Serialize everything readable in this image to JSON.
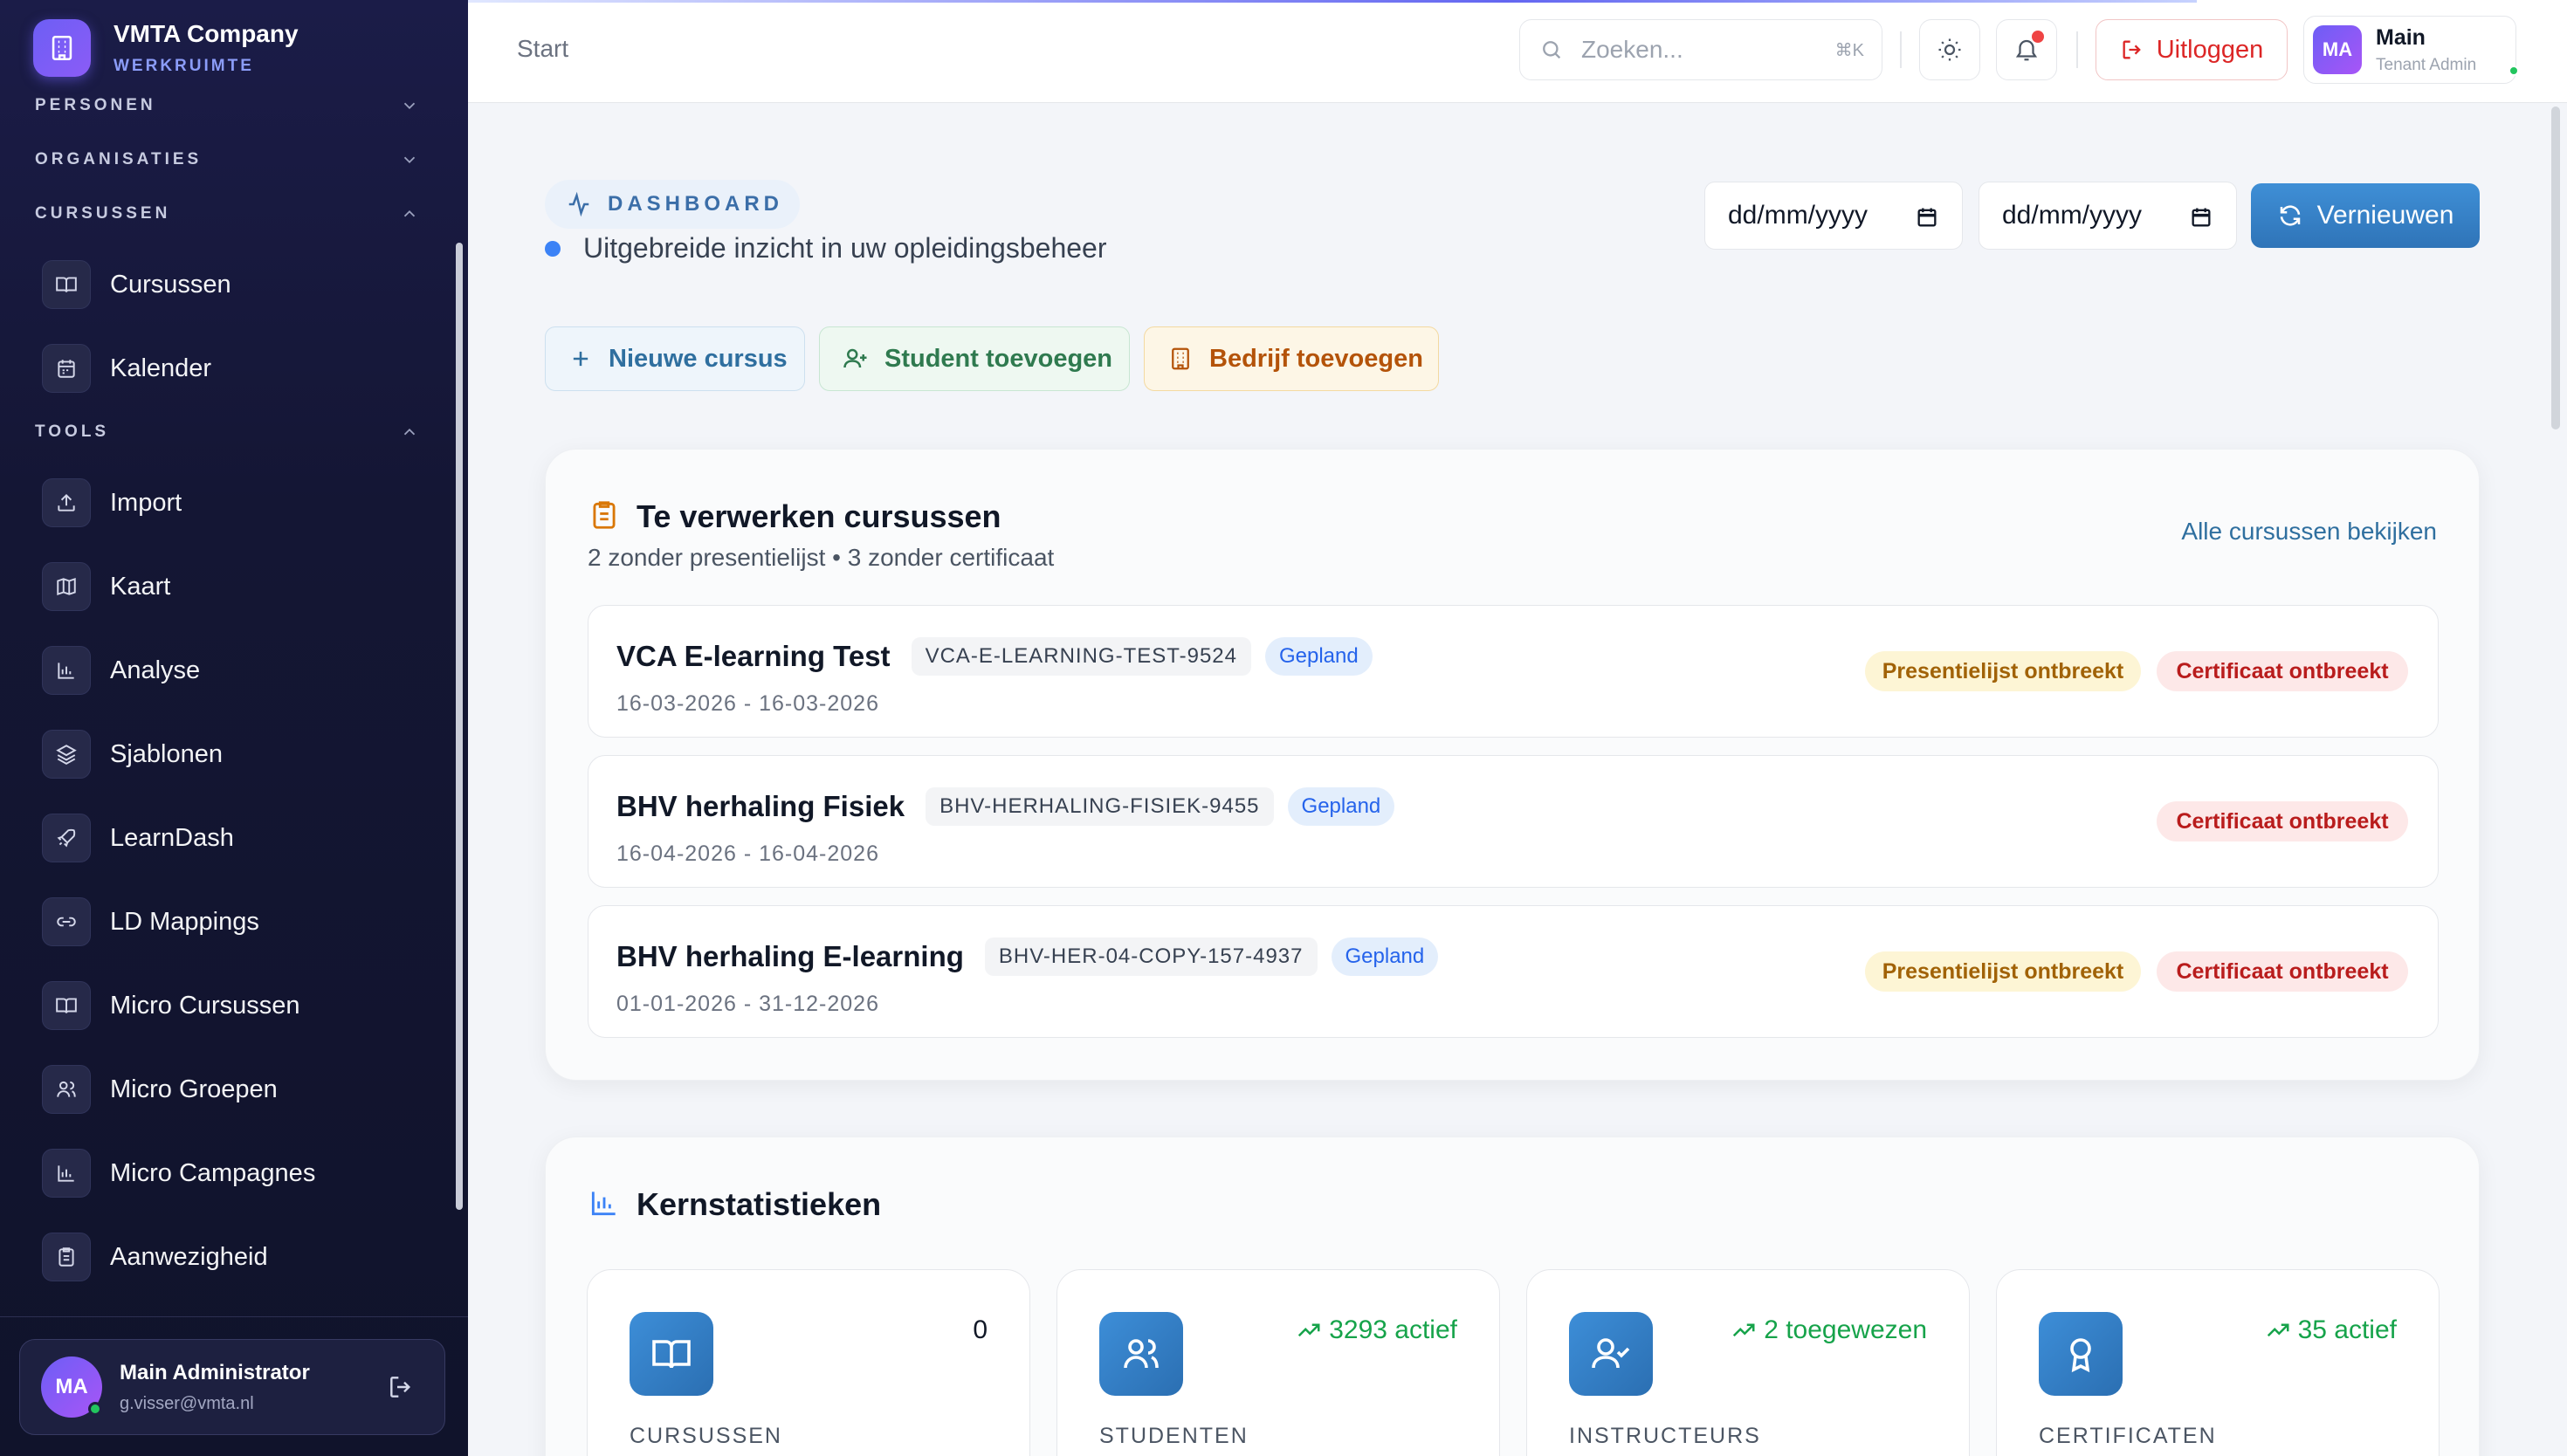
{
  "brand": {
    "name": "VMTA Company",
    "sub": "WERKRUIMTE"
  },
  "sidebar": {
    "sections": [
      {
        "label": "PERSONEN"
      },
      {
        "label": "ORGANISATIES"
      },
      {
        "label": "CURSUSSEN"
      },
      {
        "label": "TOOLS"
      }
    ],
    "items": [
      {
        "label": "Cursussen",
        "icon": "book-icon"
      },
      {
        "label": "Kalender",
        "icon": "calendar-icon"
      },
      {
        "label": "Import",
        "icon": "upload-icon"
      },
      {
        "label": "Kaart",
        "icon": "map-icon"
      },
      {
        "label": "Analyse",
        "icon": "bar-chart-icon"
      },
      {
        "label": "Sjablonen",
        "icon": "layers-icon"
      },
      {
        "label": "LearnDash",
        "icon": "rocket-icon"
      },
      {
        "label": "LD Mappings",
        "icon": "link-icon"
      },
      {
        "label": "Micro Cursussen",
        "icon": "book-icon"
      },
      {
        "label": "Micro Groepen",
        "icon": "users-icon"
      },
      {
        "label": "Micro Campagnes",
        "icon": "bar-chart-icon"
      },
      {
        "label": "Aanwezigheid",
        "icon": "clipboard-icon"
      }
    ],
    "profile": {
      "initials": "MA",
      "name": "Main Administrator",
      "email": "g.visser@vmta.nl"
    }
  },
  "topbar": {
    "breadcrumb": "Start",
    "search_placeholder": "Zoeken...",
    "search_shortcut": "⌘K",
    "logout_label": "Uitloggen",
    "user": {
      "initials": "MA",
      "name": "Main",
      "role": "Tenant Admin"
    }
  },
  "header": {
    "pill": "DASHBOARD",
    "subtitle": "Uitgebreide inzicht in uw opleidingsbeheer",
    "date_from": "dd/mm/yyyy",
    "date_to": "dd/mm/yyyy",
    "refresh_label": "Vernieuwen"
  },
  "quick_actions": [
    {
      "label": "Nieuwe cursus",
      "color": "#2f6f9f"
    },
    {
      "label": "Student toevoegen",
      "color": "#2f7a4f"
    },
    {
      "label": "Bedrijf toevoegen",
      "color": "#b45309"
    }
  ],
  "pending": {
    "title": "Te verwerken cursussen",
    "summary": "2 zonder presentielijst • 3 zonder certificaat",
    "view_all": "Alle cursussen bekijken",
    "courses": [
      {
        "title": "VCA E-learning Test",
        "code": "VCA-E-LEARNING-TEST-9524",
        "status": "Gepland",
        "dates": "16-03-2026 - 16-03-2026",
        "missing_presence": "Presentielijst ontbreekt",
        "missing_cert": "Certificaat ontbreekt"
      },
      {
        "title": "BHV herhaling Fisiek",
        "code": "BHV-HERHALING-FISIEK-9455",
        "status": "Gepland",
        "dates": "16-04-2026 - 16-04-2026",
        "missing_presence": "",
        "missing_cert": "Certificaat ontbreekt"
      },
      {
        "title": "BHV herhaling E-learning",
        "code": "BHV-HER-04-COPY-157-4937",
        "status": "Gepland",
        "dates": "01-01-2026 - 31-12-2026",
        "missing_presence": "Presentielijst ontbreekt",
        "missing_cert": "Certificaat ontbreekt"
      }
    ]
  },
  "stats": {
    "title": "Kernstatistieken",
    "items": [
      {
        "label": "CURSUSSEN",
        "value": "0",
        "icon": "book-open-icon"
      },
      {
        "label": "STUDENTEN",
        "value": "3293 actief",
        "icon": "users-icon"
      },
      {
        "label": "INSTRUCTEURS",
        "value": "2 toegewezen",
        "icon": "user-check-icon"
      },
      {
        "label": "CERTIFICATEN",
        "value": "35 actief",
        "icon": "award-icon"
      }
    ]
  },
  "colors": {
    "accent": "#2f74b8",
    "danger": "#dc2626",
    "success": "#16a34a",
    "sidebar_bg": "#141634"
  }
}
